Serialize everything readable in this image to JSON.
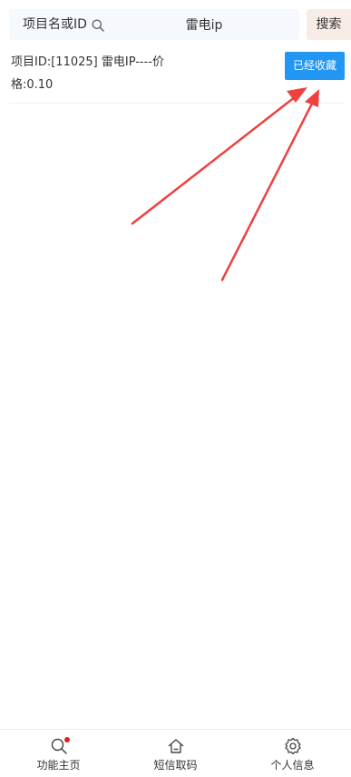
{
  "search": {
    "label": "项目名或ID",
    "value": "雷电ip",
    "button_label": "搜索"
  },
  "project": {
    "text": "项目ID:[11025] 雷电IP----价格:0.10",
    "button_label": "已经收藏"
  },
  "tabbar": {
    "items": [
      {
        "label": "功能主页",
        "icon": "search-icon",
        "badge": true
      },
      {
        "label": "短信取码",
        "icon": "home-icon"
      },
      {
        "label": "个人信息",
        "icon": "gear-icon"
      }
    ]
  },
  "colors": {
    "accent": "#2196f3",
    "search_bg": "#f5f8fd",
    "search_button_bg": "#f8ece6",
    "arrow": "#f04040",
    "badge": "#e02020"
  }
}
